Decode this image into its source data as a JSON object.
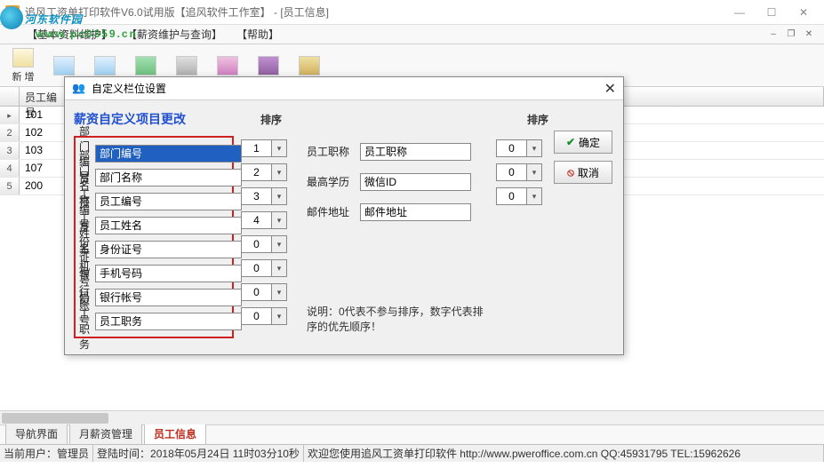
{
  "titlebar": {
    "title": "追风工资单打印软件V6.0试用版【追风软件工作室】 - [员工信息]"
  },
  "watermark": {
    "line1": "河东软件园",
    "line2": "www.pc0359.cn"
  },
  "menubar": {
    "items": [
      "【基本资料维护】",
      "【薪资维护与查询】",
      "【帮助】"
    ]
  },
  "toolbar": {
    "new_label": "新 增"
  },
  "grid": {
    "col1_header": "员工编号",
    "rows": [
      {
        "n": "1",
        "id": "101"
      },
      {
        "n": "2",
        "id": "102"
      },
      {
        "n": "3",
        "id": "103"
      },
      {
        "n": "4",
        "id": "107"
      },
      {
        "n": "5",
        "id": "200"
      }
    ]
  },
  "tabs": {
    "t1": "导航界面",
    "t2": "月薪资管理",
    "t3": "员工信息"
  },
  "statusbar": {
    "user_label": "当前用户：",
    "user_value": "管理员",
    "login_label": "登陆时间：",
    "login_value": "2018年05月24日 11时03分10秒",
    "welcome": "欢迎您使用追风工资单打印软件 http://www.pweroffice.com.cn QQ:45931795 TEL:15962626"
  },
  "dialog": {
    "title": "自定义栏位设置",
    "heading": "薪资自定义项目更改",
    "sort_header": "排序",
    "left_fields": [
      {
        "label": "部门编号",
        "value": "部门编号",
        "sort": "1",
        "selected": true
      },
      {
        "label": "部门名称",
        "value": "部门名称",
        "sort": "2"
      },
      {
        "label": "员工编号",
        "value": "员工编号",
        "sort": "3"
      },
      {
        "label": "员工姓名",
        "value": "员工姓名",
        "sort": "4"
      },
      {
        "label": "身份证号",
        "value": "身份证号",
        "sort": "0"
      },
      {
        "label": "手机号码",
        "value": "手机号码",
        "sort": "0"
      },
      {
        "label": "银行账号",
        "value": "银行帐号",
        "sort": "0"
      },
      {
        "label": "员工职务",
        "value": "员工职务",
        "sort": "0"
      }
    ],
    "right_fields": [
      {
        "label": "员工职称",
        "value": "员工职称",
        "sort": "0"
      },
      {
        "label": "最高学历",
        "value": "微信ID",
        "sort": "0"
      },
      {
        "label": "邮件地址",
        "value": "邮件地址",
        "sort": "0"
      }
    ],
    "note": "说明：0代表不参与排序，数字代表排序的优先顺序！",
    "ok_label": "确定",
    "cancel_label": "取消"
  }
}
